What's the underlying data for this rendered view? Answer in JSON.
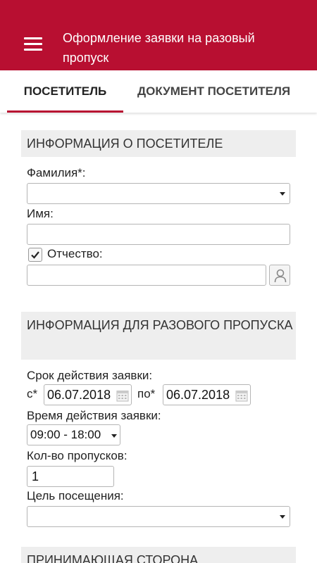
{
  "appbar": {
    "title": "Оформление заявки на разовый пропуск"
  },
  "tabs": [
    {
      "label": "ПОСЕТИТЕЛЬ",
      "active": true
    },
    {
      "label": "ДОКУМЕНТ ПОСЕТИТЕЛЯ",
      "active": false
    }
  ],
  "visitor_info": {
    "header": "ИНФОРМАЦИЯ О ПОСЕТИТЕЛЕ",
    "last_name_label": "Фамилия*:",
    "last_name_value": "",
    "first_name_label": "Имя:",
    "first_name_value": "",
    "patronymic_label": "Отчество:",
    "patronymic_checked": true,
    "patronymic_value": ""
  },
  "pass_info": {
    "header": "ИНФОРМАЦИЯ ДЛЯ РАЗОВОГО ПРОПУСКА",
    "validity_label": "Срок действия заявки:",
    "from_label": "с*",
    "from_date": "06.07.2018",
    "to_label": "по*",
    "to_date": "06.07.2018",
    "time_label": "Время действия заявки:",
    "time_value": "09:00 - 18:00",
    "count_label": "Кол-во пропусков:",
    "count_value": "1",
    "purpose_label": "Цель посещения:",
    "purpose_value": ""
  },
  "receiving_side": {
    "header": "ПРИНИМАЮЩАЯ СТОРОНА"
  },
  "colors": {
    "primary": "#b80f31",
    "section_bg": "#eeeeee"
  },
  "icons": {
    "menu": "hamburger-menu-icon",
    "dropdown": "chevron-down-icon",
    "calendar": "calendar-icon",
    "user": "user-icon",
    "check": "checkmark-icon"
  }
}
